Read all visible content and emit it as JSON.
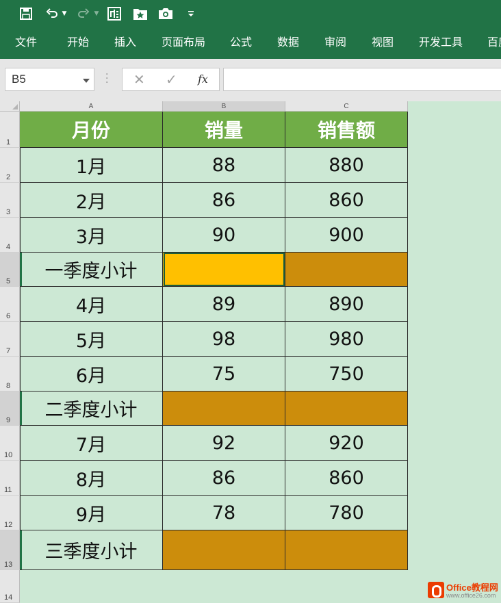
{
  "quick_access": {
    "icons": [
      "save-icon",
      "undo-icon",
      "redo-icon",
      "custom-icon",
      "favorite-folder-icon",
      "camera-icon",
      "customize-dropdown-icon"
    ]
  },
  "ribbon": {
    "tabs": [
      "文件",
      "开始",
      "插入",
      "页面布局",
      "公式",
      "数据",
      "审阅",
      "视图",
      "开发工具",
      "百度"
    ]
  },
  "formula_bar": {
    "name_box": "B5",
    "cancel": "✕",
    "enter": "✓",
    "fx": "fx",
    "formula": ""
  },
  "columns": [
    "A",
    "B",
    "C"
  ],
  "rows": [
    "1",
    "2",
    "3",
    "4",
    "5",
    "6",
    "7",
    "8",
    "9",
    "10",
    "11",
    "12",
    "13",
    "14"
  ],
  "table": {
    "headers": [
      "月份",
      "销量",
      "销售额"
    ],
    "rows": [
      [
        "1月",
        "88",
        "880"
      ],
      [
        "2月",
        "86",
        "860"
      ],
      [
        "3月",
        "90",
        "900"
      ],
      [
        "一季度小计",
        "",
        ""
      ],
      [
        "4月",
        "89",
        "890"
      ],
      [
        "5月",
        "98",
        "980"
      ],
      [
        "6月",
        "75",
        "750"
      ],
      [
        "二季度小计",
        "",
        ""
      ],
      [
        "7月",
        "92",
        "920"
      ],
      [
        "8月",
        "86",
        "860"
      ],
      [
        "9月",
        "78",
        "780"
      ],
      [
        "三季度小计",
        "",
        ""
      ]
    ]
  },
  "colors": {
    "ribbon": "#217346",
    "header_fill": "#70ad47",
    "subtotal_fill": "#cc8d0c",
    "active_fill": "#ffc000",
    "sheet_bg": "#cce8d4"
  },
  "watermark": {
    "title": "Office教程网",
    "url": "www.office26.com"
  }
}
